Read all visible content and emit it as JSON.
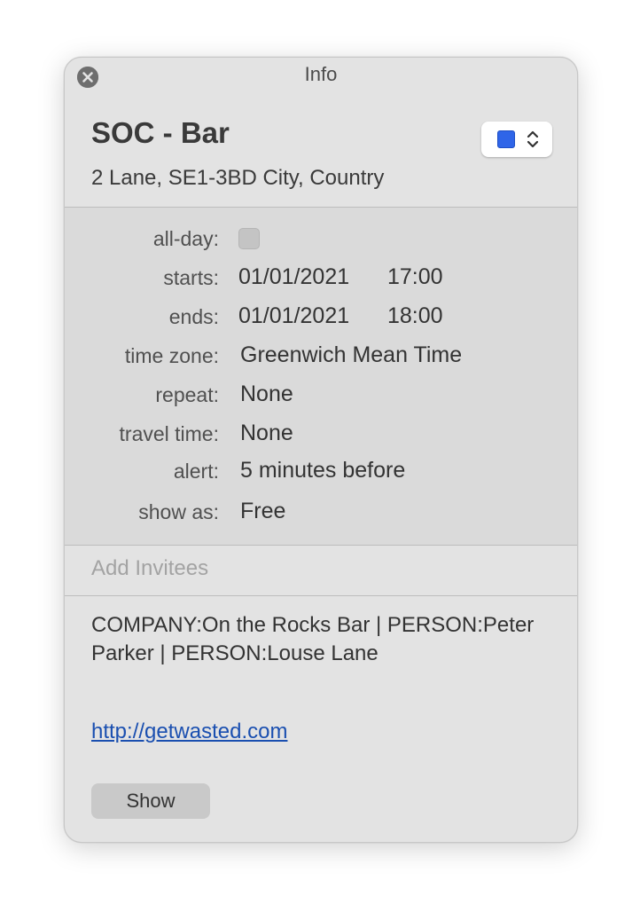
{
  "window": {
    "title": "Info"
  },
  "event": {
    "title": "SOC - Bar",
    "location": "2 Lane, SE1-3BD City, Country",
    "calendar_color": "#2f65e8"
  },
  "details": {
    "all_day": {
      "label": "all-day:",
      "checked": false
    },
    "starts": {
      "label": "starts:",
      "date": "01/01/2021",
      "time": "17:00"
    },
    "ends": {
      "label": "ends:",
      "date": "01/01/2021",
      "time": "18:00"
    },
    "time_zone": {
      "label": "time zone:",
      "value": "Greenwich Mean Time"
    },
    "repeat": {
      "label": "repeat:",
      "value": "None"
    },
    "travel_time": {
      "label": "travel time:",
      "value": "None"
    },
    "alert": {
      "label": "alert:",
      "value": "5 minutes before"
    },
    "show_as": {
      "label": "show as:",
      "value": "Free"
    }
  },
  "invitees": {
    "placeholder": "Add Invitees"
  },
  "notes": {
    "text": "COMPANY:On the Rocks Bar | PERSON:Peter Parker | PERSON:Louse Lane",
    "url": "http://getwasted.com"
  },
  "actions": {
    "show_label": "Show"
  },
  "icons": {
    "close": "close-icon",
    "stepper": "chevron-up-down-icon"
  }
}
